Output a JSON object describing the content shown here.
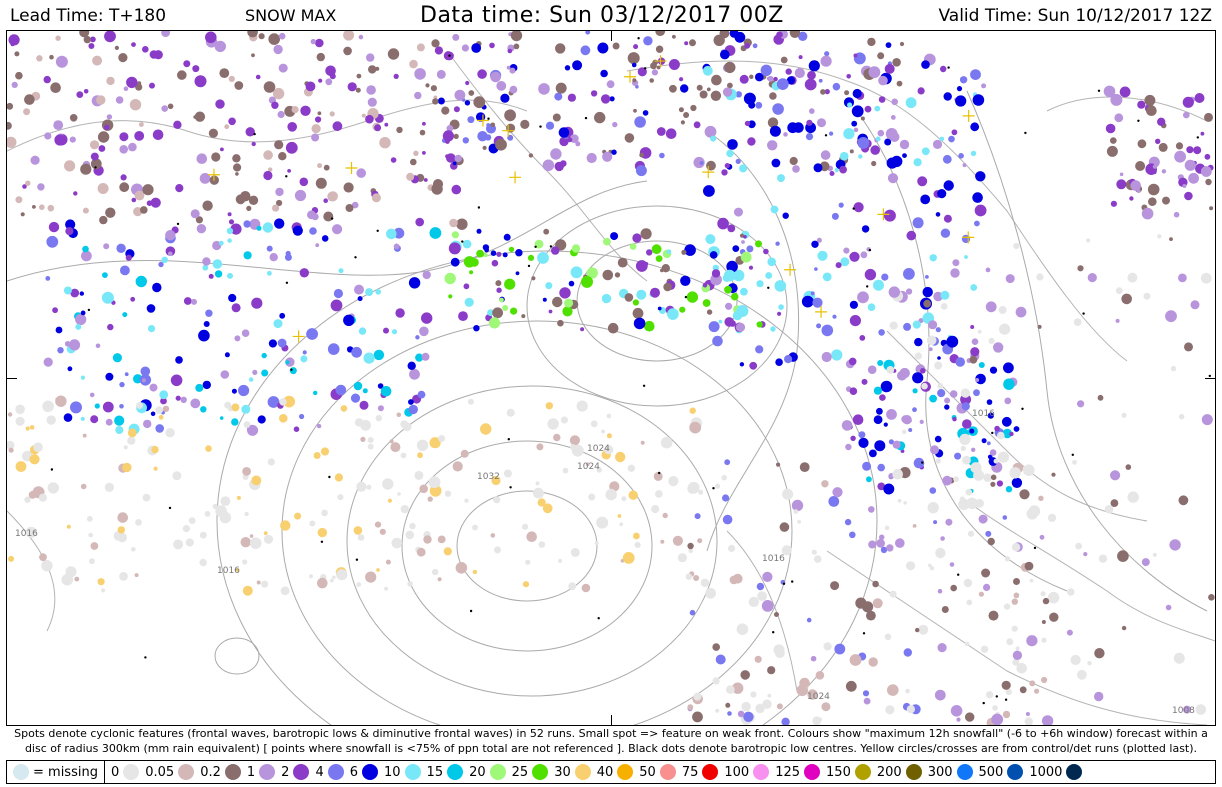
{
  "header": {
    "lead_time": "Lead Time: T+180",
    "field": "SNOW MAX",
    "data_time": "Data time:  Sun 03/12/2017 00Z",
    "valid_time": "Valid Time: Sun 10/12/2017 12Z"
  },
  "caption": {
    "line1": "Spots denote cyclonic features (frontal waves, barotropic lows & diminutive frontal waves) in 52 runs. Small spot => feature on weak front. Colours show \"maximum 12h snowfall\" (-6 to +6h window) forecast within a",
    "line2": "disc of radius 300km (mm rain equivalent) [ points where snowfall is <75% of ppn total are not referenced ]. Black dots denote barotropic low centres. Yellow circles/crosses are from control/det runs (plotted last)."
  },
  "legend": {
    "missing_label": "= missing",
    "missing_color": "#d6e8f0",
    "items": [
      {
        "label": "0",
        "color": "#e6e6e6"
      },
      {
        "label": "0.05",
        "color": "#d4b8b8"
      },
      {
        "label": "0.2",
        "color": "#8a6e6e"
      },
      {
        "label": "1",
        "color": "#b894dc"
      },
      {
        "label": "2",
        "color": "#8a3cc8"
      },
      {
        "label": "4",
        "color": "#7a78f0"
      },
      {
        "label": "6",
        "color": "#0000e0"
      },
      {
        "label": "10",
        "color": "#78e8f8"
      },
      {
        "label": "15",
        "color": "#00c8e8"
      },
      {
        "label": "20",
        "color": "#a0f878"
      },
      {
        "label": "25",
        "color": "#50e000"
      },
      {
        "label": "30",
        "color": "#f8d070"
      },
      {
        "label": "40",
        "color": "#f8b000"
      },
      {
        "label": "50",
        "color": "#f89090"
      },
      {
        "label": "75",
        "color": "#f00000"
      },
      {
        "label": "100",
        "color": "#f890f0"
      },
      {
        "label": "125",
        "color": "#e000c0"
      },
      {
        "label": "150",
        "color": "#b0a000"
      },
      {
        "label": "200",
        "color": "#706000"
      },
      {
        "label": "300",
        "color": "#1078f8"
      },
      {
        "label": "500",
        "color": "#0050b0"
      },
      {
        "label": "1000",
        "color": "#002850"
      }
    ]
  },
  "map": {
    "isobar_labels": [
      "1032",
      "1024",
      "1016",
      "1016",
      "1016",
      "1024",
      "1008",
      "1016",
      "1024"
    ]
  }
}
